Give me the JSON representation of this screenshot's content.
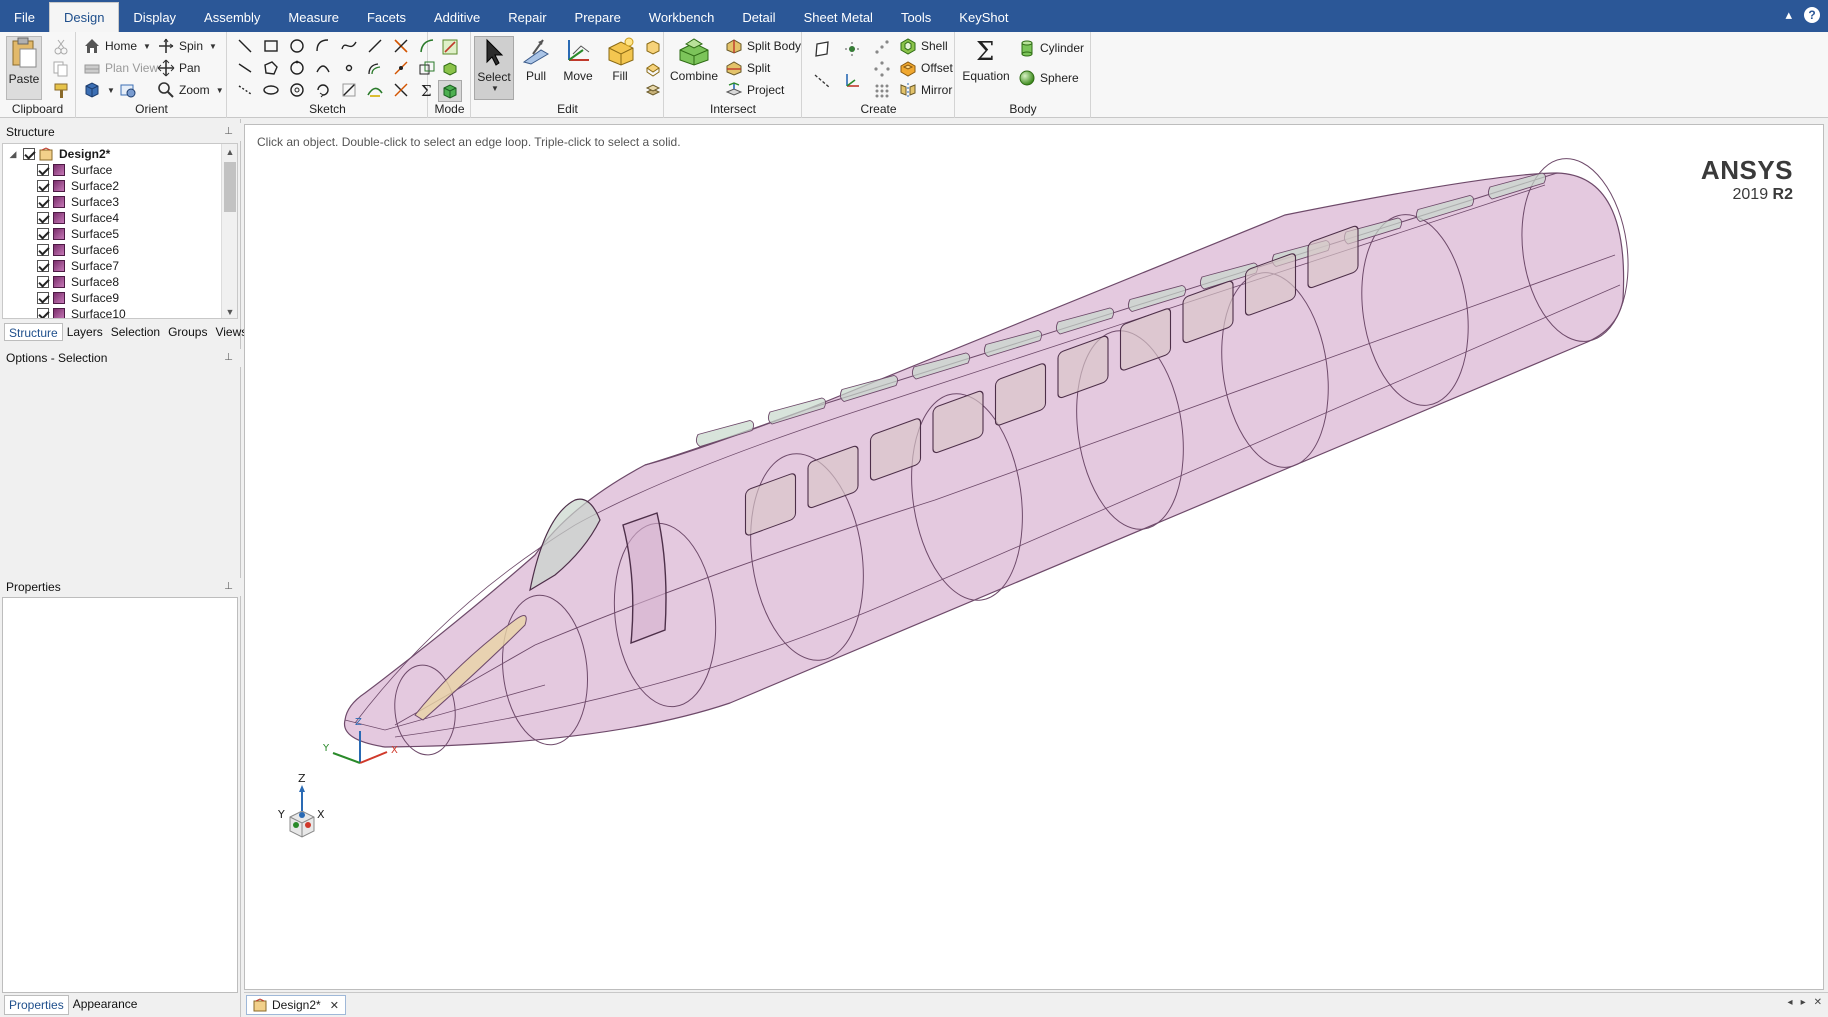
{
  "menu": {
    "tabs": [
      "File",
      "Design",
      "Display",
      "Assembly",
      "Measure",
      "Facets",
      "Additive",
      "Repair",
      "Prepare",
      "Workbench",
      "Detail",
      "Sheet Metal",
      "Tools",
      "KeyShot"
    ],
    "active": "Design",
    "minimize_glyph": "▴",
    "help_glyph": "?"
  },
  "ribbon": {
    "clipboard": {
      "label": "Clipboard",
      "paste": "Paste"
    },
    "orient": {
      "label": "Orient",
      "home": "Home",
      "spin": "Spin",
      "plan_view": "Plan View",
      "pan": "Pan",
      "zoom": "Zoom"
    },
    "sketch": {
      "label": "Sketch"
    },
    "mode": {
      "label": "Mode"
    },
    "edit": {
      "label": "Edit",
      "select": "Select",
      "pull": "Pull",
      "move": "Move",
      "fill": "Fill"
    },
    "intersect": {
      "label": "Intersect",
      "combine": "Combine",
      "split_body": "Split Body",
      "split": "Split",
      "project": "Project"
    },
    "create": {
      "label": "Create",
      "shell": "Shell",
      "offset": "Offset",
      "mirror": "Mirror"
    },
    "body": {
      "label": "Body",
      "equation": "Equation",
      "cylinder": "Cylinder",
      "sphere": "Sphere"
    }
  },
  "structure": {
    "title": "Structure",
    "pin_glyph": "⊥",
    "root": "Design2*",
    "items": [
      "Surface",
      "Surface2",
      "Surface3",
      "Surface4",
      "Surface5",
      "Surface6",
      "Surface7",
      "Surface8",
      "Surface9",
      "Surface10"
    ],
    "tabs": [
      "Structure",
      "Layers",
      "Selection",
      "Groups",
      "Views"
    ],
    "active_tab": "Structure"
  },
  "options": {
    "title": "Options - Selection"
  },
  "properties": {
    "title": "Properties",
    "tabs": [
      "Properties",
      "Appearance"
    ],
    "active_tab": "Properties"
  },
  "viewport": {
    "hint": "Click an object. Double-click to select an edge loop. Triple-click to select a solid.",
    "brand_name": "ANSYS",
    "brand_year": "2019",
    "brand_release": "R2",
    "axis_labels": {
      "x": "X",
      "y": "Y",
      "z": "Z"
    }
  },
  "document": {
    "tab_label": "Design2*",
    "close_glyph": "✕",
    "nav_glyphs": [
      "◂",
      "▸",
      "✕"
    ]
  },
  "colors": {
    "menubar": "#2b5797",
    "body_fill": "#dcb8d6",
    "body_edge": "#6e4a6a",
    "window_fill": "#c8d8cc"
  }
}
